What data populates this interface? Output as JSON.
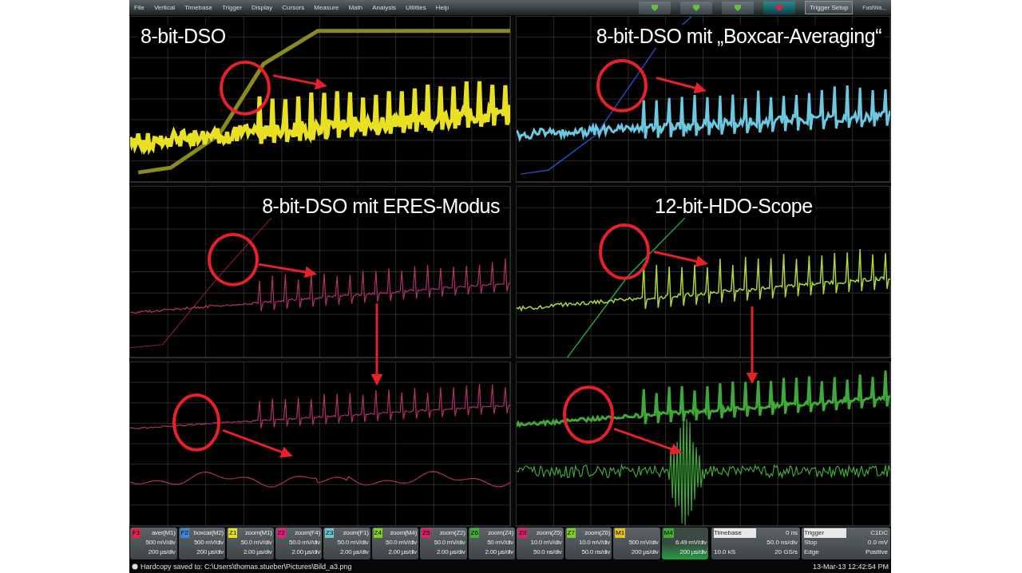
{
  "menu": [
    "File",
    "Vertical",
    "Timebase",
    "Trigger",
    "Display",
    "Cursors",
    "Measure",
    "Math",
    "Analysis",
    "Utilities",
    "Help"
  ],
  "toolbar": {
    "trigger_button": "Trigger Setup",
    "label": "FastWa..."
  },
  "panels": [
    {
      "title": "8-bit-DSO",
      "kind": "band",
      "color": "#e8e020"
    },
    {
      "title": "8-bit-DSO mit „Boxcar-Averaging“",
      "kind": "boxcar",
      "color": "#6cc8e0"
    },
    {
      "title": "8-bit-DSO mit ERES-Modus",
      "kind": "eres",
      "color": "#b0306a"
    },
    {
      "title": "12-bit-HDO-Scope",
      "kind": "hdo",
      "color": "#a8d838"
    },
    {
      "kind": "eres-detail",
      "color": "#b0306a"
    },
    {
      "kind": "hdo-detail",
      "color": "#40a838"
    }
  ],
  "descriptors": [
    {
      "tag": "F1",
      "source": "aver(M1)",
      "vdiv": "500 mV/div",
      "tdiv": "200 µs/div",
      "color": "#e0204a",
      "selected": false
    },
    {
      "tag": "F2",
      "source": "boxcar(M2)",
      "vdiv": "500 mV/div",
      "tdiv": "200 µs/div",
      "color": "#3a8ad8",
      "selected": false
    },
    {
      "tag": "Z1",
      "source": "zoom(M1)",
      "vdiv": "50.0 mV/div",
      "tdiv": "2.00 µs/div",
      "color": "#e8e020",
      "selected": false
    },
    {
      "tag": "Z2",
      "source": "zoom(F4)",
      "vdiv": "50.0 mV/div",
      "tdiv": "2.00 µs/div",
      "color": "#e02080",
      "selected": false
    },
    {
      "tag": "Z3",
      "source": "zoom(F1)",
      "vdiv": "50.0 mV/div",
      "tdiv": "2.00 µs/div",
      "color": "#6cc8d0",
      "selected": false
    },
    {
      "tag": "Z4",
      "source": "zoom(M4)",
      "vdiv": "50.0 mV/div",
      "tdiv": "2.00 µs/div",
      "color": "#80d020",
      "selected": false
    },
    {
      "tag": "Z5",
      "source": "zoom(Z2)",
      "vdiv": "50.0 mV/div",
      "tdiv": "2.00 µs/div",
      "color": "#e0206a",
      "selected": false
    },
    {
      "tag": "Z6",
      "source": "zoom(Z4)",
      "vdiv": "50 mV/div",
      "tdiv": "2.00 µs/div",
      "color": "#40b030",
      "selected": false
    },
    {
      "tag": "Z8",
      "source": "zoom(Z5)",
      "vdiv": "10.0 mV/div",
      "tdiv": "50.0 ns/div",
      "color": "#e0206a",
      "selected": false
    },
    {
      "tag": "Z7",
      "source": "zoom(Z6)",
      "vdiv": "10.0 mV/div",
      "tdiv": "50.0 ns/div",
      "color": "#80d020",
      "selected": false
    },
    {
      "tag": "M1",
      "vdiv": "500 mV/div",
      "tdiv": "200 µs/div",
      "color": "#e8c020",
      "selected": false
    },
    {
      "tag": "M4",
      "vdiv": "6.49 mV/div",
      "tdiv": "200 µs/div",
      "color": "#40b030",
      "selected": true
    }
  ],
  "timebase": {
    "label": "Timebase",
    "delay": "0 ns",
    "tdiv": "50.0 ns/div",
    "samples": "10.0 kS",
    "rate": "20 GS/s"
  },
  "trigger": {
    "label": "Trigger",
    "source": "C1DC",
    "mode": "Stop",
    "level": "0.0 mV",
    "type": "Edge",
    "slope": "Positive"
  },
  "datetime": "13-Mar-13 12:42:54 PM",
  "status": "Hardcopy saved to: C:\\Users\\thomas.stueber\\Pictures\\Bild_a3.png"
}
